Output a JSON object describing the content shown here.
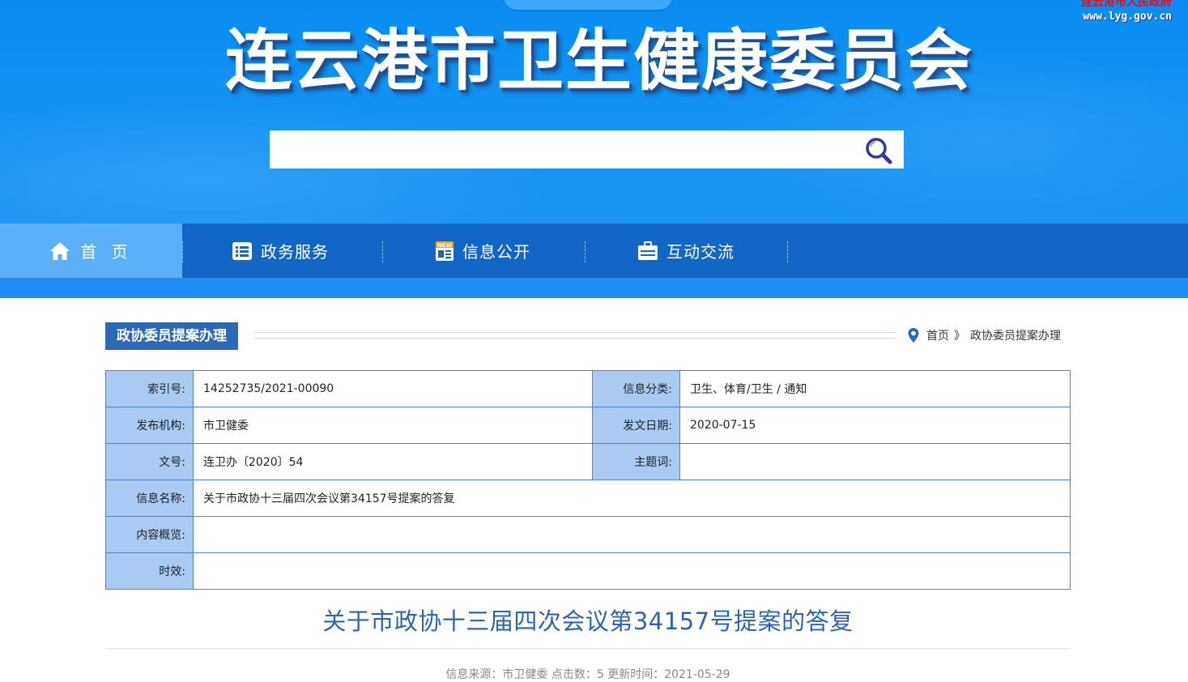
{
  "site": {
    "title": "连云港市卫生健康委员会",
    "gov_name": "连云港市人民政府",
    "gov_url": "www.lyg.gov.cn"
  },
  "search": {
    "placeholder": "",
    "icon": "search-icon"
  },
  "nav": {
    "items": [
      {
        "label": "首 页",
        "icon": "home-icon",
        "active": true
      },
      {
        "label": "政务服务",
        "icon": "list-icon"
      },
      {
        "label": "信息公开",
        "icon": "news-icon"
      },
      {
        "label": "互动交流",
        "icon": "briefcase-icon"
      }
    ]
  },
  "section": {
    "title": "政协委员提案办理",
    "breadcrumb": {
      "home": "首页",
      "separator": "》",
      "current": "政协委员提案办理"
    }
  },
  "meta": {
    "index_label": "索引号:",
    "index_value": "14252735/2021-00090",
    "category_label": "信息分类:",
    "category_value": "卫生、体育/卫生 / 通知",
    "publisher_label": "发布机构:",
    "publisher_value": "市卫健委",
    "date_label": "发文日期:",
    "date_value": "2020-07-15",
    "doc_no_label": "文号:",
    "doc_no_value": "连卫办〔2020〕54",
    "keywords_label": "主题词:",
    "keywords_value": "",
    "name_label": "信息名称:",
    "name_value": "关于市政协十三届四次会议第34157号提案的答复",
    "summary_label": "内容概览:",
    "summary_value": "",
    "validity_label": "时效:",
    "validity_value": ""
  },
  "article": {
    "title": "关于市政协十三届四次会议第34157号提案的答复",
    "info": "信息来源：市卫健委 点击数：5 更新时间：2021-05-29"
  },
  "colors": {
    "banner": "#1292f5",
    "nav": "#1166c6",
    "nav_active": "#5cb0f5",
    "table_label_bg": "#a8caf3",
    "table_border": "#4d86cf",
    "article_title": "#2a64b4"
  }
}
